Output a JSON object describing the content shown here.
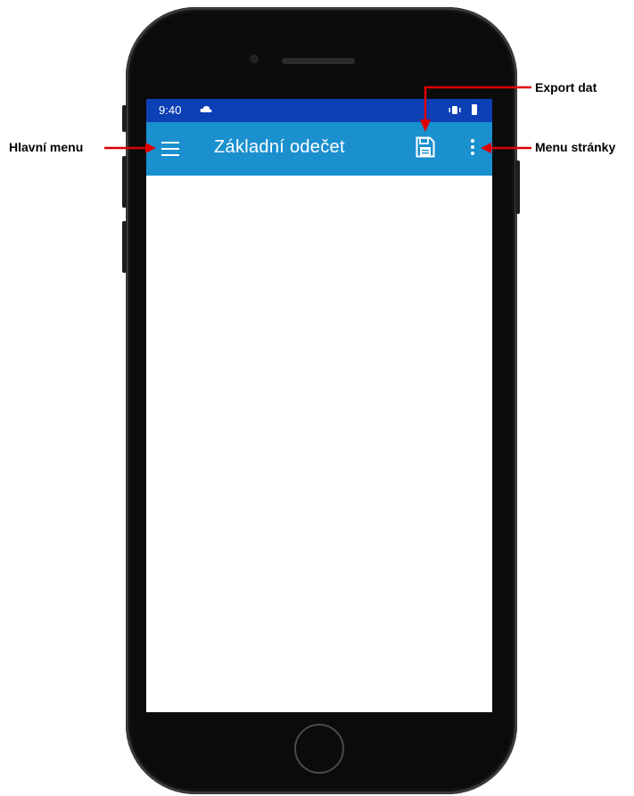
{
  "status_bar": {
    "time": "9:40",
    "icons": [
      "cloud-icon",
      "vibrate-icon",
      "battery-icon"
    ]
  },
  "app_bar": {
    "title": "Základní odečet",
    "background": "#1a90cf",
    "status_background": "#0d3fb5",
    "icons": [
      "hamburger-menu-icon",
      "floppy-disk-save-icon",
      "more-vert-icon"
    ]
  },
  "annotations": {
    "main_menu": "Hlavní menu",
    "export": "Export dat",
    "page_menu": "Menu stránky",
    "arrow_color": "#e00000"
  }
}
